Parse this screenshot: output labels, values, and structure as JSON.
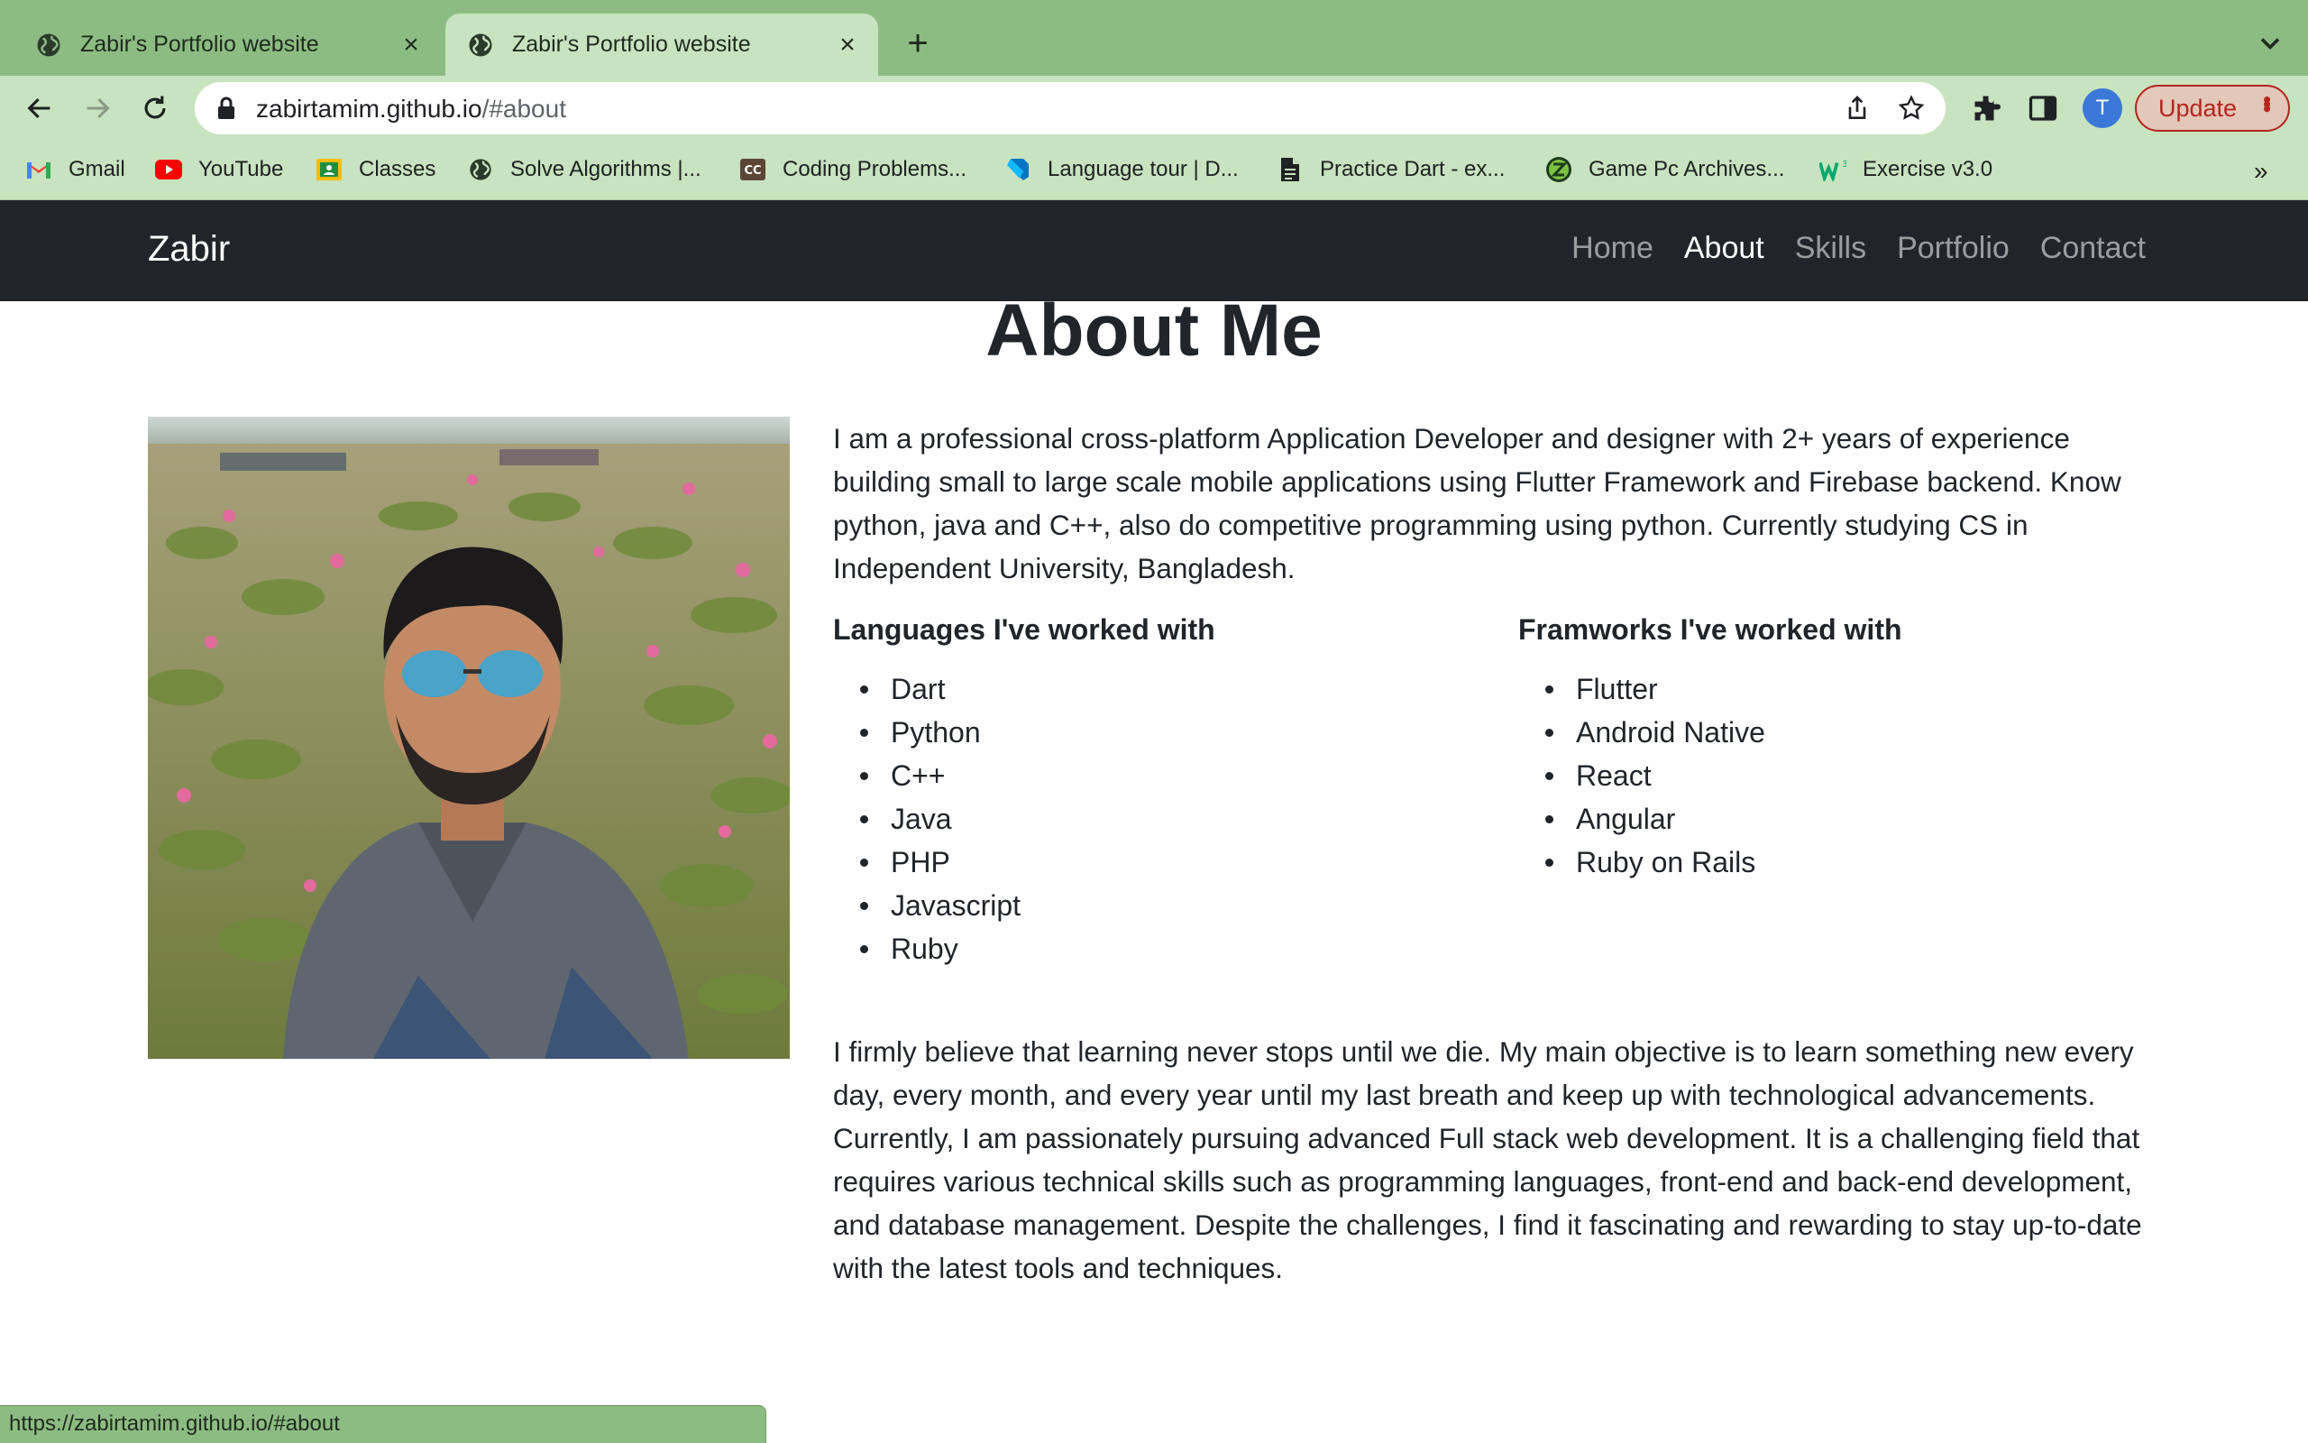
{
  "browser": {
    "tabs": [
      {
        "title": "Zabir's Portfolio website",
        "active": false
      },
      {
        "title": "Zabir's Portfolio website",
        "active": true
      }
    ],
    "url_host": "zabirtamim.github.io",
    "url_path": "/#about",
    "profile_initial": "T",
    "update_label": "Update",
    "bookmarks": [
      {
        "label": "Gmail",
        "icon": "gmail-icon"
      },
      {
        "label": "YouTube",
        "icon": "youtube-icon"
      },
      {
        "label": "Classes",
        "icon": "classes-icon"
      },
      {
        "label": "Solve Algorithms |...",
        "icon": "globe-icon"
      },
      {
        "label": "Coding Problems...",
        "icon": "cc-icon"
      },
      {
        "label": "Language tour | D...",
        "icon": "dart-icon"
      },
      {
        "label": "Practice Dart - ex...",
        "icon": "document-icon"
      },
      {
        "label": "Game Pc Archives...",
        "icon": "z-logo-icon"
      },
      {
        "label": "Exercise v3.0",
        "icon": "w3-icon"
      }
    ],
    "bookmarks_overflow": "»",
    "status_url": "https://zabirtamim.github.io/#about"
  },
  "navbar": {
    "brand": "Zabir",
    "links": [
      {
        "label": "Home",
        "active": false
      },
      {
        "label": "About",
        "active": true
      },
      {
        "label": "Skills",
        "active": false
      },
      {
        "label": "Portfolio",
        "active": false
      },
      {
        "label": "Contact",
        "active": false
      }
    ]
  },
  "about": {
    "heading": "About Me",
    "intro": "I am a professional cross-platform Application Developer and designer with 2+ years of experience building small to large scale mobile applications using Flutter Framework and Firebase backend. Know python, java and C++, also do competitive programming using python. Currently studying CS in Independent University, Bangladesh.",
    "languages_title": "Languages I've worked with",
    "languages": [
      "Dart",
      "Python",
      "C++",
      "Java",
      "PHP",
      "Javascript",
      "Ruby"
    ],
    "frameworks_title": "Framworks I've worked with",
    "frameworks": [
      "Flutter",
      "Android Native",
      "React",
      "Angular",
      "Ruby on Rails"
    ],
    "outro": "I firmly believe that learning never stops until we die. My main objective is to learn something new every day, every month, and every year until my last breath and keep up with technological advancements. Currently, I am passionately pursuing advanced Full stack web development. It is a challenging field that requires various technical skills such as programming languages, front-end and back-end development, and database management. Despite the challenges, I find it fascinating and rewarding to stay up-to-date with the latest tools and techniques."
  },
  "colors": {
    "chrome_tabstrip": "#8cbc82",
    "chrome_toolbar": "#c8e3bf",
    "navbar_bg": "#212529",
    "update_accent": "#b3261e"
  }
}
